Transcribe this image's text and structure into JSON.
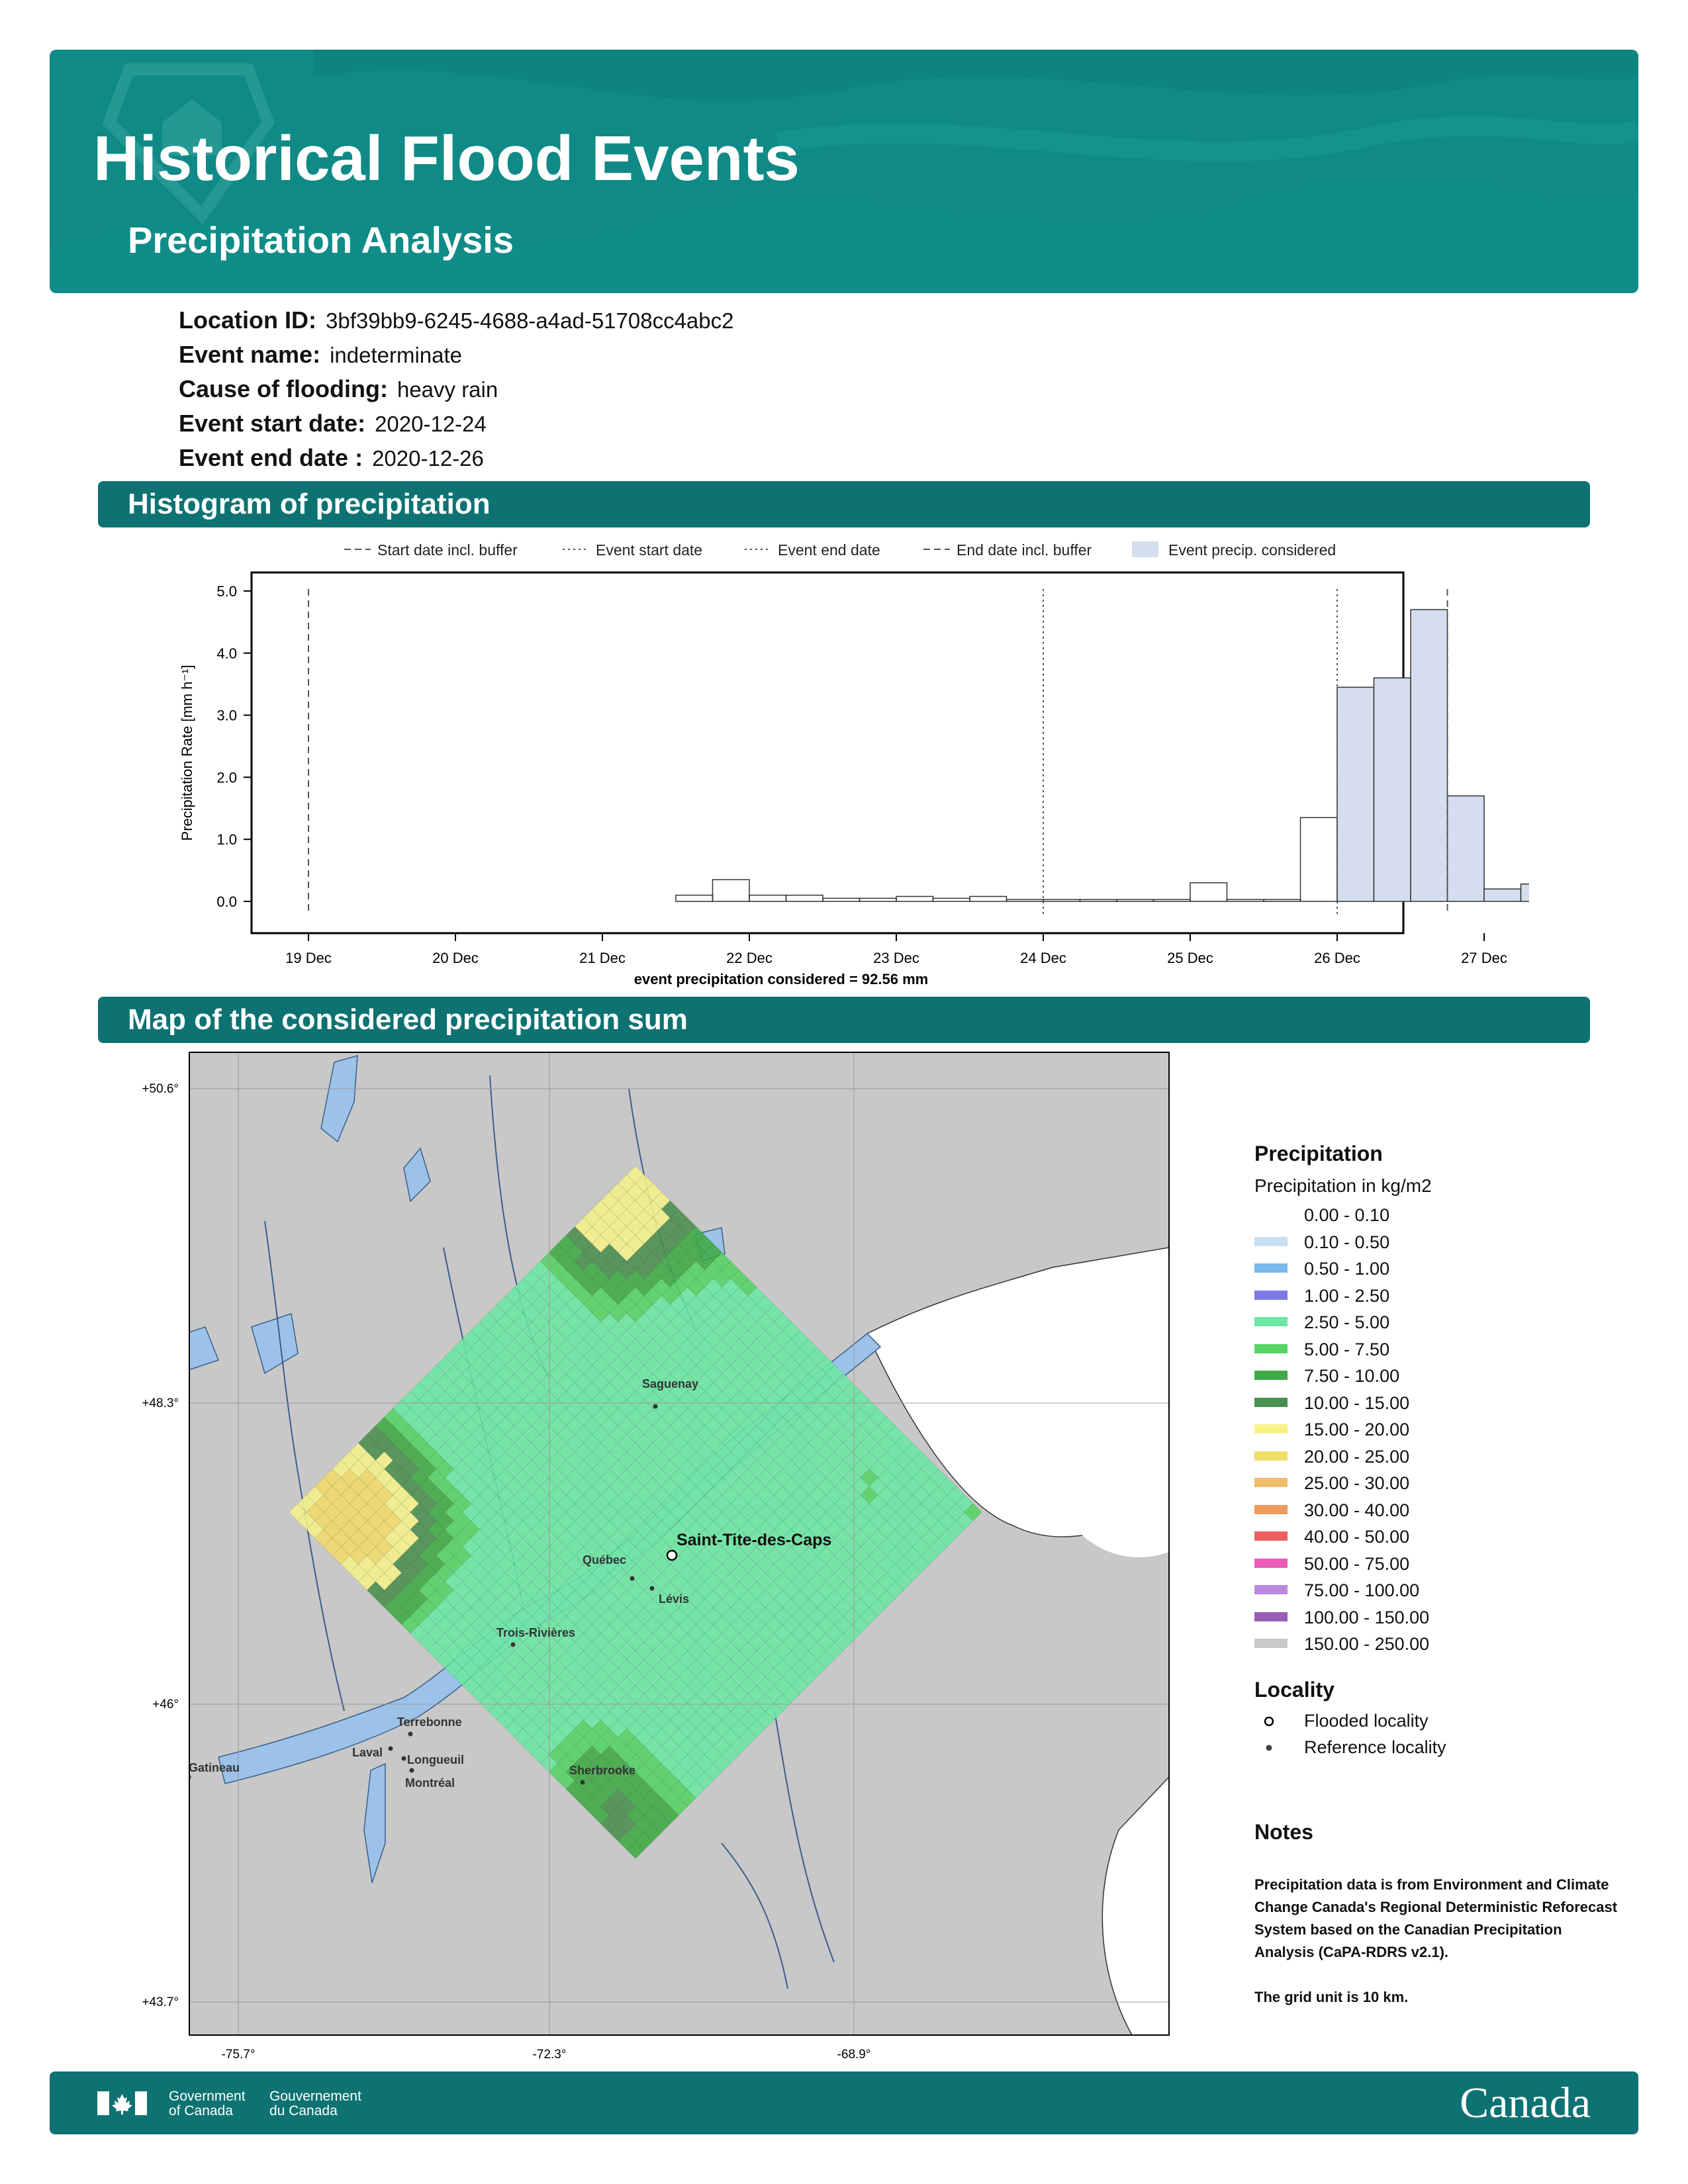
{
  "banner": {
    "title": "Historical Flood Events",
    "subtitle": "Precipitation Analysis",
    "color": "#0f8a86"
  },
  "meta": {
    "location_id_label": "Location ID:",
    "location_id": "3bf39bb9-6245-4688-a4ad-51708cc4abc2",
    "event_name_label": "Event name:",
    "event_name": "indeterminate",
    "cause_label": "Cause of flooding:",
    "cause": "heavy rain",
    "start_label": "Event start date:",
    "start": "2020-12-24",
    "end_label": "Event end date :",
    "end": "2020-12-26"
  },
  "sections": {
    "histogram": "Histogram of precipitation",
    "map": "Map of the considered precipitation sum"
  },
  "chart_data": {
    "type": "bar",
    "xlabel": "event precipitation considered = 92.56 mm",
    "ylabel": "Precipitation Rate [mm h⁻¹]",
    "ylim": [
      0,
      5.0
    ],
    "yticks": [
      "0.0",
      "1.0",
      "2.0",
      "3.0",
      "4.0",
      "5.0"
    ],
    "xticks": [
      "19 Dec",
      "20 Dec",
      "21 Dec",
      "22 Dec",
      "23 Dec",
      "24 Dec",
      "25 Dec",
      "26 Dec",
      "27 Dec"
    ],
    "legend": [
      "Start date incl. buffer",
      "Event start date",
      "Event end date",
      "End date incl. buffer",
      "Event precip. considered"
    ],
    "legend_position": "top",
    "markers": {
      "start_buffer": 0,
      "event_start": 5,
      "event_end": 7,
      "end_buffer": 7.75
    },
    "bin_hours": 6,
    "series": [
      {
        "values": [
          0,
          0,
          0,
          0,
          0,
          0,
          0,
          0,
          0,
          0,
          0.1,
          0.35,
          0.1,
          0.1,
          0.05,
          0.05,
          0.08,
          0.05,
          0.08,
          0.03,
          0.03,
          0.03,
          0.03,
          0.03,
          0.3,
          0.03,
          0.03,
          1.35,
          3.45,
          3.6,
          4.7,
          1.7,
          0.2,
          0.28,
          0.03
        ]
      }
    ],
    "event_bins": [
      28,
      35
    ]
  },
  "map": {
    "lat_ticks": [
      "+50.6°",
      "+48.3°",
      "+46°",
      "+43.7°"
    ],
    "lon_ticks": [
      "-75.7°",
      "-72.3°",
      "-68.9°"
    ],
    "flooded": "Saint-Tite-des-Caps",
    "cities": [
      "Saguenay",
      "Québec",
      "Lévis",
      "Trois-Rivières",
      "Terrebonne",
      "Laval",
      "Longueuil",
      "Montréal",
      "Gatineau",
      "Sherbrooke"
    ]
  },
  "legend": {
    "title": "Precipitation",
    "subtitle": "Precipitation in kg/m2",
    "items": [
      {
        "label": "0.00 - 0.10",
        "color": "#ffffff"
      },
      {
        "label": "0.10 - 0.50",
        "color": "#c6e0f5"
      },
      {
        "label": "0.50 - 1.00",
        "color": "#79b8ea"
      },
      {
        "label": "1.00 - 2.50",
        "color": "#7a7ae6"
      },
      {
        "label": "2.50 - 5.00",
        "color": "#6be8a3"
      },
      {
        "label": "5.00 - 7.50",
        "color": "#55d464"
      },
      {
        "label": "7.50 - 10.00",
        "color": "#3fab45"
      },
      {
        "label": "10.00 - 15.00",
        "color": "#4a8f4f"
      },
      {
        "label": "15.00 - 20.00",
        "color": "#f6f28a"
      },
      {
        "label": "20.00 - 25.00",
        "color": "#f2dc6a"
      },
      {
        "label": "25.00 - 30.00",
        "color": "#efbd68"
      },
      {
        "label": "30.00 - 40.00",
        "color": "#ef9a5e"
      },
      {
        "label": "40.00 - 50.00",
        "color": "#ef5e5e"
      },
      {
        "label": "50.00 - 75.00",
        "color": "#e85cb8"
      },
      {
        "label": "75.00 - 100.00",
        "color": "#bd88e0"
      },
      {
        "label": "100.00 - 150.00",
        "color": "#9a5cb6"
      },
      {
        "label": "150.00 - 250.00",
        "color": "#c8c8c8"
      }
    ],
    "locality_title": "Locality",
    "flooded_label": "Flooded locality",
    "reference_label": "Reference locality"
  },
  "notes": {
    "title": "Notes",
    "text1": "Precipitation data is from Environment and Climate Change Canada's Regional Deterministic Reforecast System based on the Canadian Precipitation Analysis (CaPA-RDRS v2.1).",
    "text2": "The grid unit is 10 km."
  },
  "footer": {
    "gov_en1": "Government",
    "gov_en2": "of Canada",
    "gov_fr1": "Gouvernement",
    "gov_fr2": "du Canada",
    "wordmark": "Canada"
  }
}
